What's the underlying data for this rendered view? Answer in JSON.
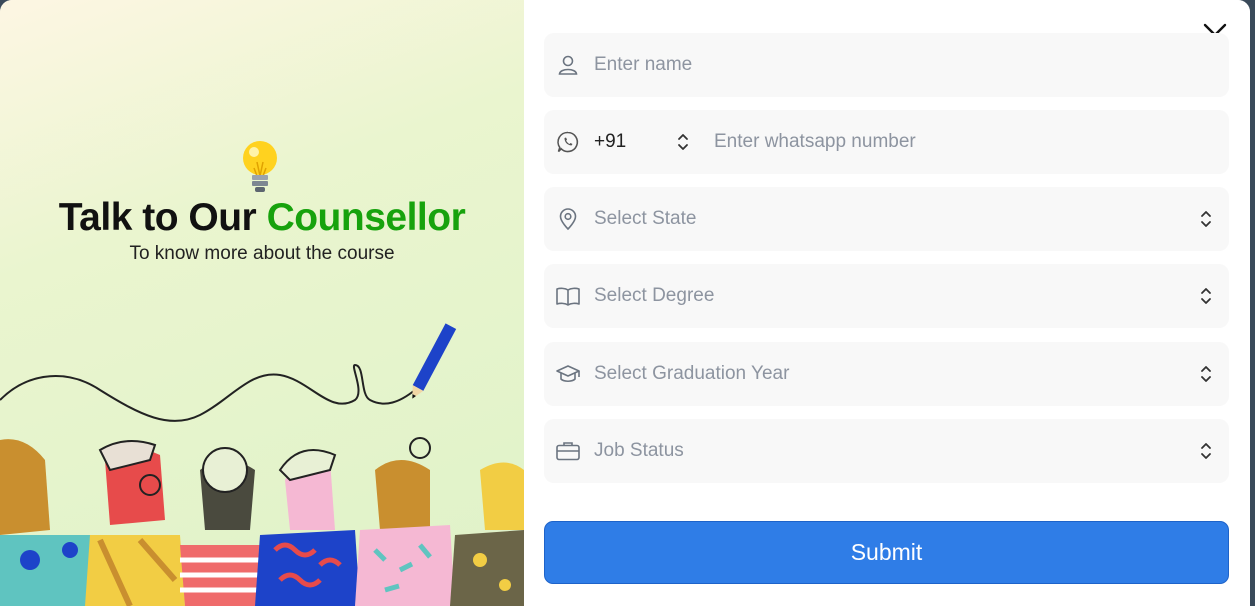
{
  "promo": {
    "heading_main": "Talk to Our",
    "heading_accent": "Counsellor",
    "subheading": "To know more about the course"
  },
  "form": {
    "name_placeholder": "Enter name",
    "country_code": "+91",
    "whatsapp_placeholder": "Enter whatsapp number",
    "state_placeholder": "Select State",
    "degree_placeholder": "Select Degree",
    "graduation_year_placeholder": "Select Graduation Year",
    "job_status_placeholder": "Job Status",
    "submit_label": "Submit"
  },
  "colors": {
    "accent_green": "#17a20d",
    "submit_blue": "#2f7de7",
    "field_bg": "#f8f8f8",
    "placeholder": "#8d94a0"
  },
  "icons": {
    "name": "user-icon",
    "whatsapp": "whatsapp-icon",
    "state": "map-pin-icon",
    "degree": "book-icon",
    "graduation": "graduation-cap-icon",
    "job": "briefcase-icon",
    "close": "close-icon"
  }
}
